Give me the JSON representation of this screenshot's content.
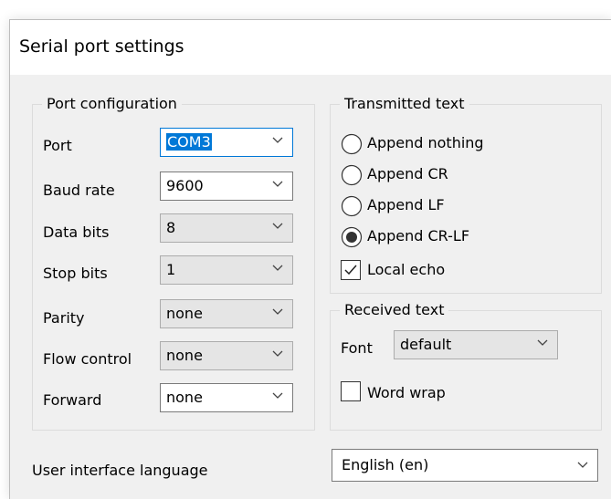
{
  "title": "Serial port settings",
  "port_config": {
    "legend": "Port configuration",
    "rows": [
      {
        "label": "Port",
        "value": "COM3"
      },
      {
        "label": "Baud rate",
        "value": "9600"
      },
      {
        "label": "Data bits",
        "value": "8"
      },
      {
        "label": "Stop bits",
        "value": "1"
      },
      {
        "label": "Parity",
        "value": "none"
      },
      {
        "label": "Flow control",
        "value": "none"
      },
      {
        "label": "Forward",
        "value": "none"
      }
    ]
  },
  "transmitted": {
    "legend": "Transmitted text",
    "options": [
      "Append nothing",
      "Append CR",
      "Append LF",
      "Append CR-LF"
    ],
    "selected": "Append CR-LF",
    "local_echo_label": "Local echo",
    "local_echo_checked": true
  },
  "received": {
    "legend": "Received text",
    "font_label": "Font",
    "font_value": "default",
    "word_wrap_label": "Word wrap",
    "word_wrap_checked": false
  },
  "ui_language": {
    "label": "User interface language",
    "value": "English (en)"
  },
  "colors": {
    "accent": "#0078d7",
    "dialog_bg": "#f0f0f0"
  }
}
